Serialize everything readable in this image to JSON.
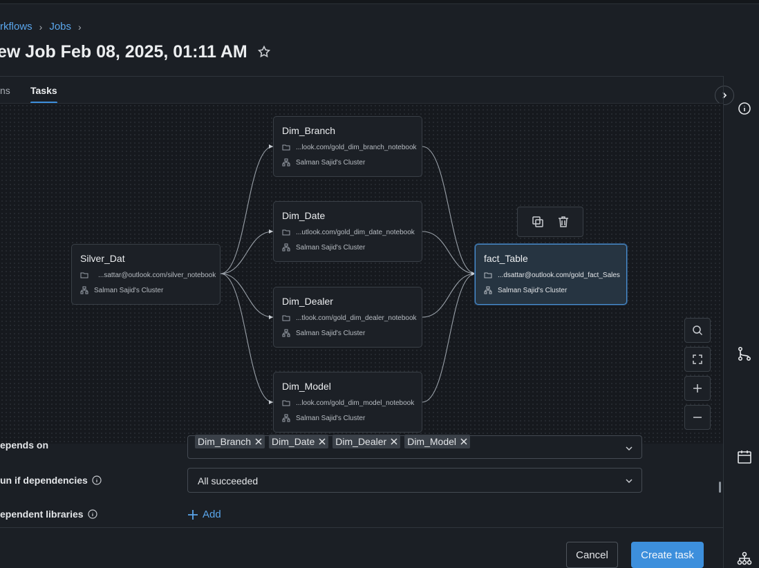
{
  "breadcrumb": {
    "items": [
      "rkflows",
      "Jobs"
    ]
  },
  "page": {
    "title": "ew Job Feb 08, 2025, 01:11 AM"
  },
  "tabs": [
    {
      "label": "ns",
      "active": false
    },
    {
      "label": "Tasks",
      "active": true
    }
  ],
  "graph": {
    "nodes": [
      {
        "name": "Silver_Dat",
        "path": "...sattar@outlook.com/silver_notebook",
        "cluster": "Salman Sajid's Cluster"
      },
      {
        "name": "Dim_Branch",
        "path": "...look.com/gold_dim_branch_notebook",
        "cluster": "Salman Sajid's Cluster"
      },
      {
        "name": "Dim_Date",
        "path": "...utlook.com/gold_dim_date_notebook",
        "cluster": "Salman Sajid's Cluster"
      },
      {
        "name": "Dim_Dealer",
        "path": "...tlook.com/gold_dim_dealer_notebook",
        "cluster": "Salman Sajid's Cluster"
      },
      {
        "name": "Dim_Model",
        "path": "...look.com/gold_dim_model_notebook",
        "cluster": "Salman Sajid's Cluster"
      },
      {
        "name": "fact_Table",
        "path": "...dsattar@outlook.com/gold_fact_Sales",
        "cluster": "Salman Sajid's Cluster",
        "selected": true
      }
    ]
  },
  "form": {
    "depends_on_label": "epends on",
    "depends_on_values": [
      "Dim_Branch",
      "Dim_Date",
      "Dim_Dealer",
      "Dim_Model"
    ],
    "run_if_label": "un if dependencies",
    "run_if_value": "All succeeded",
    "libraries_label": "ependent libraries",
    "add_label": "Add"
  },
  "footer": {
    "cancel_label": "Cancel",
    "create_label": "Create task"
  },
  "colors": {
    "accent": "#3d8fdc",
    "link": "#5aa6ec",
    "selected_node": "#263441"
  },
  "icons": {
    "right_rail": [
      "info-icon",
      "git-branch-icon",
      "calendar-icon",
      "hierarchy-icon"
    ],
    "canvas_controls": [
      "search-icon",
      "fit-view-icon",
      "zoom-in-icon",
      "zoom-out-icon"
    ]
  }
}
